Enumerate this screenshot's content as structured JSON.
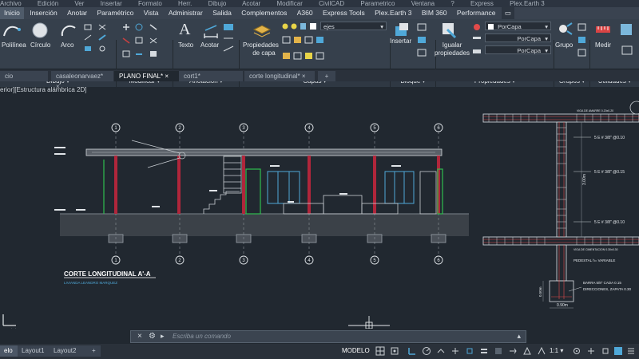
{
  "titlebar": {
    "items": [
      "Archivo",
      "Edición",
      "Ver",
      "Insertar",
      "Formato",
      "Herr.",
      "Dibujo",
      "Acotar",
      "Modificar",
      "CivilCAD",
      "Parametrico",
      "Ventana",
      "?",
      "Express",
      "Plex.Earth 3"
    ]
  },
  "menubar": {
    "items": [
      "Inicio",
      "Inserción",
      "Anotar",
      "Paramétrico",
      "Vista",
      "Administrar",
      "Salida",
      "Complementos",
      "A360",
      "Express Tools",
      "Plex.Earth 3",
      "BIM 360",
      "Performance"
    ]
  },
  "ribbon": {
    "polyline": "Polilínea",
    "circle": "Círculo",
    "arc": "Arco",
    "text": "Texto",
    "dimension": "Acotar",
    "layer_properties": [
      "Propiedades",
      "de capa"
    ],
    "layer_name": "ejes",
    "insert": "Insertar",
    "match_properties": [
      "Igualar",
      "propiedades"
    ],
    "color": "PorCapa",
    "linetype": "PorCapa",
    "lineweight": "PorCapa",
    "group": "Grupo",
    "measure": "Medir",
    "panels": [
      "Dibujo",
      "Modificar",
      "Anotación",
      "Capas",
      "Bloque",
      "Propiedades",
      "Grupos",
      "Utilidades"
    ]
  },
  "doctabs": [
    "cio",
    "casaleonarvaez*",
    "PLANO FINAL*",
    "cort1*",
    "corte longitudinal*"
  ],
  "viewport_label": "erior][Estructura alámbrica 2D]",
  "drawing": {
    "section_title": "CORTE LONGITUDINAL A'-A",
    "section_subtitle": "LIVIANDA LEANDRO MARQUEZ",
    "axis_numbers": [
      "1",
      "2",
      "3",
      "4",
      "5",
      "6"
    ],
    "detail": {
      "stirrup_labels": [
        "5 E # 3/8\" @0.10",
        "5 E # 3/8\" @0.15",
        "5 E # 3/8\" @0.10"
      ],
      "beam_top": "VIGA DE AMARRE 0.20x0.20",
      "beam_bottom": "VIGA DE CIMENTACION 0.30x0.30",
      "height_dim": "3.00m",
      "pedestal": "PEDESTAL h= VARIABLE",
      "footing_note": [
        "BARRA 5/8\"  CADA 0.15",
        "DIRECCIONES, ZAPATA 0.30"
      ],
      "footing_dim": "0.90m",
      "footing_height": "0.50m"
    }
  },
  "command": {
    "placeholder": "Escriba un comando"
  },
  "status": {
    "layout_tabs": [
      "elo",
      "Layout1",
      "Layout2"
    ],
    "mode": "MODELO",
    "scale": "1:1"
  },
  "colors": {
    "background": "#212830",
    "ribbon": "#36404c",
    "beam": "#c9ced3",
    "column": "#b0263b",
    "green": "#2fbf4f",
    "cyan": "#4fa8d8"
  }
}
